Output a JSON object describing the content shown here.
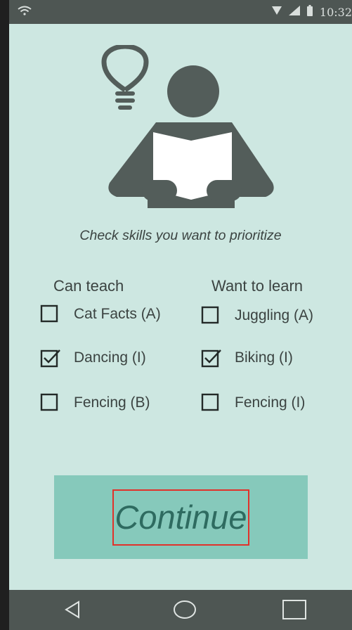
{
  "status_bar": {
    "time": "10:32",
    "icons": [
      "wifi-icon",
      "signal-icon",
      "cellular-icon",
      "battery-icon"
    ]
  },
  "hero": {
    "icons": [
      "lightbulb-icon",
      "reading-person-icon"
    ]
  },
  "prompt": "Check skills you want to prioritize",
  "columns": {
    "teach": {
      "header": "Can teach",
      "items": [
        {
          "label": "Cat Facts (A)",
          "checked": false
        },
        {
          "label": "Dancing (I)",
          "checked": true
        },
        {
          "label": "Fencing (B)",
          "checked": false
        }
      ]
    },
    "learn": {
      "header": "Want to learn",
      "items": [
        {
          "label": "Juggling (A)",
          "checked": false
        },
        {
          "label": "Biking (I)",
          "checked": true
        },
        {
          "label": "Fencing (I)",
          "checked": false
        }
      ]
    }
  },
  "continue_button": {
    "label": "Continue"
  },
  "nav_bar": {
    "icons": [
      "back-icon",
      "home-icon",
      "recents-icon"
    ]
  },
  "colors": {
    "background": "#cde7e1",
    "bars": "#4e5653",
    "button": "#86c9bb",
    "button_text": "#2e6b60",
    "icon": "#535d5a",
    "highlight": "#e1312a"
  }
}
